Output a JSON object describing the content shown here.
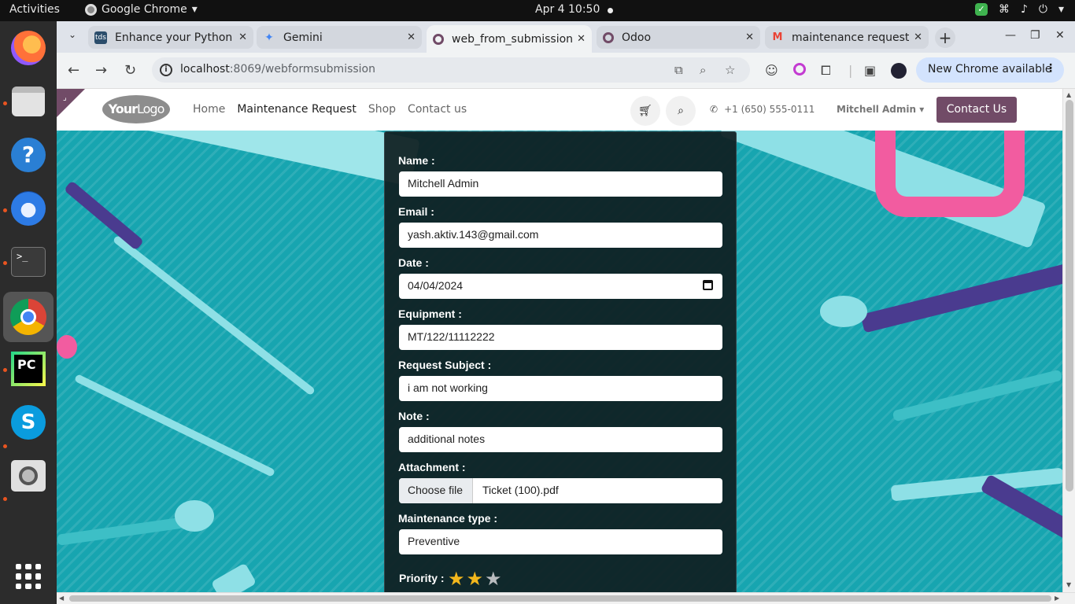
{
  "topbar": {
    "activities": "Activities",
    "app_name": "Google Chrome",
    "clock": "Apr 4  10:50"
  },
  "dock": {
    "items": [
      "firefox-icon",
      "files-icon",
      "help-icon",
      "thunderbird-icon",
      "terminal-icon",
      "chrome-icon",
      "pycharm-icon",
      "skype-icon",
      "image-viewer-icon",
      "app-grid-icon"
    ]
  },
  "tabs": [
    {
      "label": "Enhance your Python",
      "favicon": "tds",
      "active": false
    },
    {
      "label": "Gemini",
      "favicon": "gemini",
      "active": false
    },
    {
      "label": "web_from_submission",
      "favicon": "odoo",
      "active": true
    },
    {
      "label": "Odoo",
      "favicon": "odoo",
      "active": false
    },
    {
      "label": "maintenance request",
      "favicon": "gmail",
      "active": false
    }
  ],
  "toolbar": {
    "url_host": "localhost",
    "url_path": ":8069/webformsubmission",
    "new_chrome": "New Chrome available"
  },
  "site": {
    "logo_bold": "Your",
    "logo_light": "Logo",
    "nav": [
      "Home",
      "Maintenance Request",
      "Shop",
      "Contact us"
    ],
    "phone": "+1 (650) 555-0111",
    "user": "Mitchell Admin",
    "contact_button": "Contact Us"
  },
  "form": {
    "fields": [
      {
        "label": "Name :",
        "value": "Mitchell Admin"
      },
      {
        "label": "Email :",
        "value": "yash.aktiv.143@gmail.com"
      },
      {
        "label": "Date :",
        "value": "04/04/2024"
      },
      {
        "label": "Equipment :",
        "value": "MT/122/11112222"
      },
      {
        "label": "Request Subject :",
        "value": "i am not working"
      },
      {
        "label": "Note :",
        "value": "additional notes"
      },
      {
        "label": "Attachment :",
        "button": "Choose file",
        "value": "Ticket  (100).pdf"
      },
      {
        "label": "Maintenance type :",
        "value": "Preventive"
      }
    ],
    "priority_label": "Priority :",
    "priority": {
      "rating": 2,
      "max": 3
    },
    "colors": {
      "star_on": "#f3b71c",
      "star_off": "#b9bcbf",
      "accent": "#714b67"
    }
  }
}
